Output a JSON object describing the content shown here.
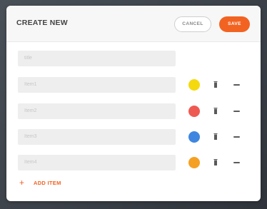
{
  "dialog": {
    "title": "CREATE NEW",
    "cancel_label": "CANCEL",
    "save_label": "SAVE"
  },
  "title_field": {
    "placeholder": "title"
  },
  "items": [
    {
      "placeholder": "Item1",
      "color": "#f5d90f",
      "color_name": "yellow"
    },
    {
      "placeholder": "Item2",
      "color": "#ee5a52",
      "color_name": "red"
    },
    {
      "placeholder": "Item3",
      "color": "#3f86e0",
      "color_name": "blue"
    },
    {
      "placeholder": "Item4",
      "color": "#f5a023",
      "color_name": "orange"
    }
  ],
  "add_item": {
    "icon": "plus-icon",
    "label": "ADD ITEM"
  },
  "colors": {
    "accent": "#f26322"
  }
}
